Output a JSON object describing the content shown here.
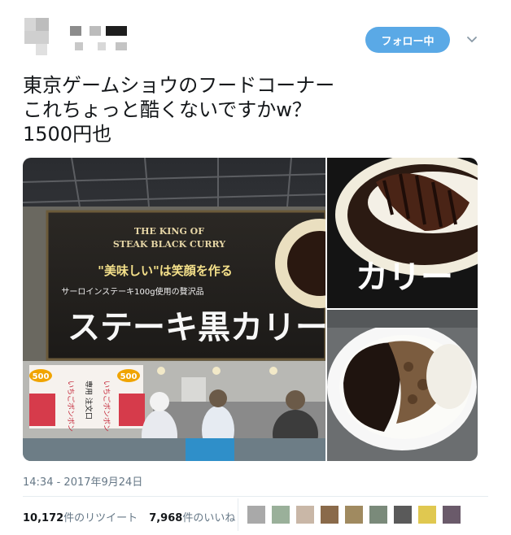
{
  "tweet": {
    "follow_label": "フォロー中",
    "lines": [
      "東京ゲームショウのフードコーナー",
      "これちょっと酷くないですかw？",
      "1500円也"
    ],
    "timestamp": "14:34 - 2017年9月24日"
  },
  "media": {
    "banner": {
      "title_en_1": "THE KING OF",
      "title_en_2": "STEAK BLACK CURRY",
      "slogan": "\"美味しい\"は笑顔を作る",
      "sub": "サーロインステーキ100g使用の贅沢品",
      "main": "ステーキ黒カリー",
      "right_text": "カリー"
    },
    "sign": {
      "price": "500",
      "left_text": "いちごボンボン",
      "mid_text": "専用 注文口",
      "right_text": "いちごボンボン"
    }
  },
  "stats": {
    "retweets_count": "10,172",
    "retweets_label": "件のリツイート",
    "likes_count": "7,968",
    "likes_label": "件のいいね"
  },
  "colors": {
    "follow_bg": "#5aa9e6",
    "text": "#14171a",
    "meta": "#657786"
  }
}
